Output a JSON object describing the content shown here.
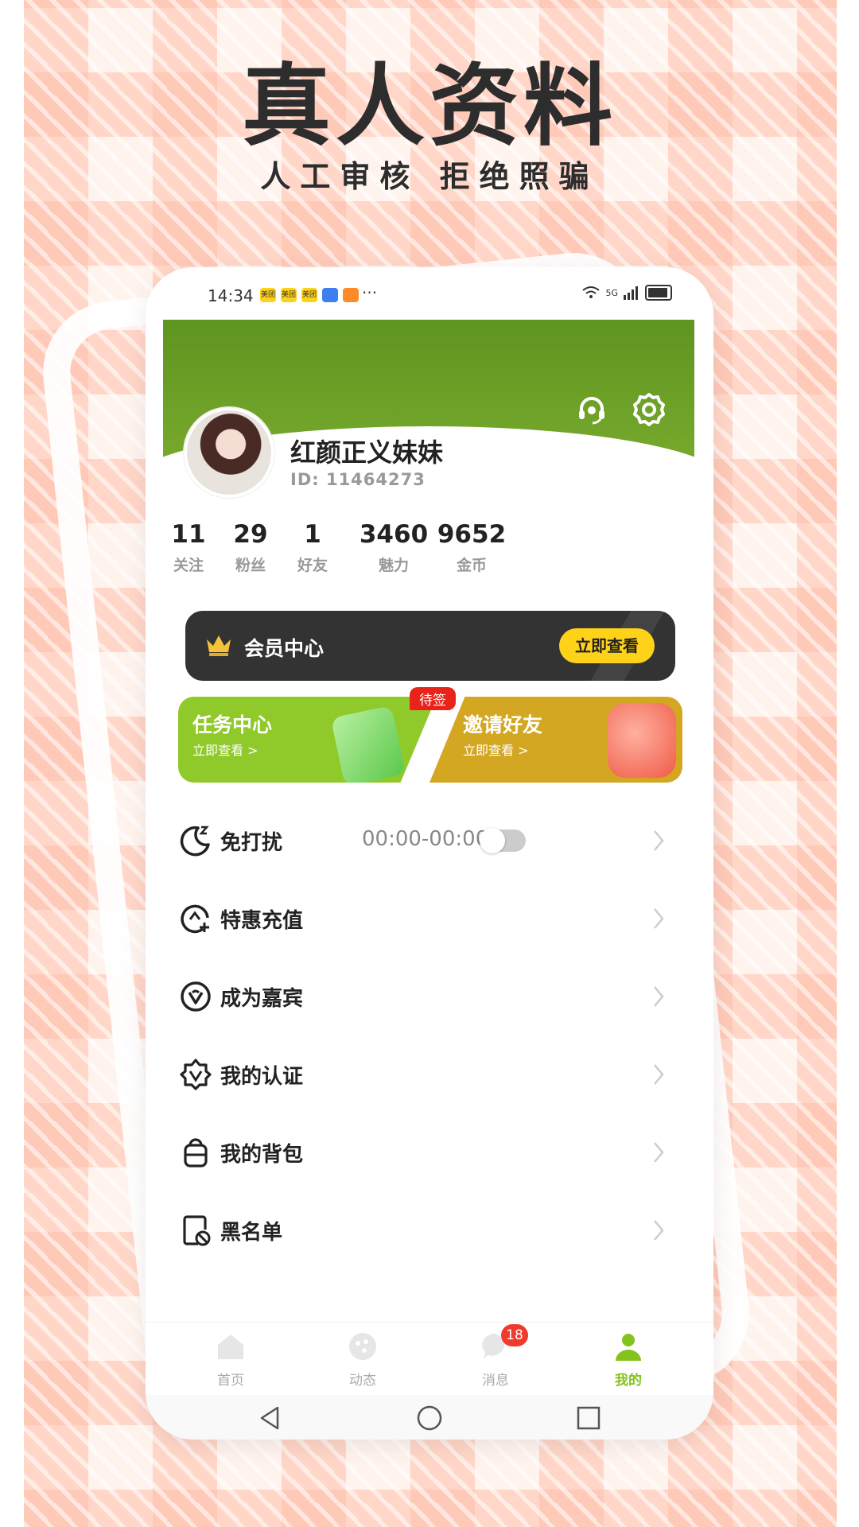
{
  "promo": {
    "headline": "真人资料",
    "subline": "人工审核  拒绝照骗"
  },
  "status_bar": {
    "time": "14:34",
    "notif_icons": [
      "美团",
      "美团",
      "美团"
    ],
    "more": "···",
    "network": "5G"
  },
  "header": {
    "support_icon": "headset-icon",
    "settings_icon": "gear-icon"
  },
  "profile": {
    "nickname": "红颜正义妹妹",
    "id_text": "ID:  11464273"
  },
  "stats": [
    {
      "value": "11",
      "label": "关注"
    },
    {
      "value": "29",
      "label": "粉丝"
    },
    {
      "value": "1",
      "label": "好友"
    },
    {
      "value": "3460",
      "label": "魅力"
    },
    {
      "value": "9652",
      "label": "金币"
    }
  ],
  "vip": {
    "title": "会员中心",
    "button": "立即查看"
  },
  "cards": {
    "task_title": "任务中心",
    "task_sub": "立即查看 >",
    "task_badge": "待签",
    "invite_title": "邀请好友",
    "invite_sub": "立即查看 >"
  },
  "menu": {
    "dnd_label": "免打扰",
    "dnd_time": "00:00-00:00",
    "dnd_enabled": false,
    "recharge_label": "特惠充值",
    "guest_label": "成为嘉宾",
    "cert_label": "我的认证",
    "bag_label": "我的背包",
    "blacklist_label": "黑名单"
  },
  "tabs": {
    "home": "首页",
    "moments": "动态",
    "messages": "消息",
    "messages_badge": "18",
    "mine": "我的",
    "active": "mine",
    "active_color": "#84c21d"
  },
  "colors": {
    "header_green": "#6fa325",
    "vip_bg": "#333333",
    "vip_button": "#ffd21a",
    "task_green": "#8fc92a",
    "invite_gold": "#d4a723",
    "badge_red": "#e8231a"
  }
}
